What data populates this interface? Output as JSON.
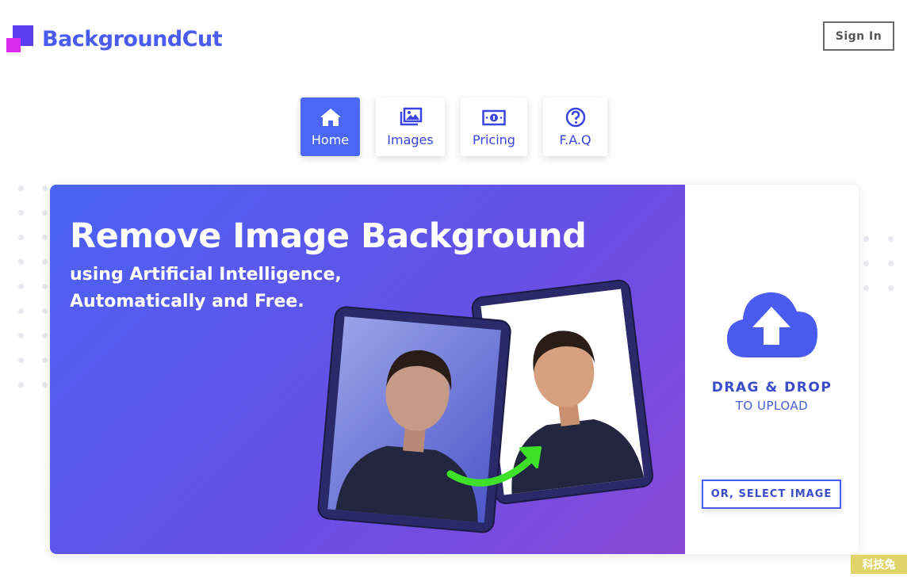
{
  "brand": {
    "name": "BackgroundCut"
  },
  "header": {
    "signin_label": "Sign In"
  },
  "nav": {
    "tabs": [
      {
        "label": "Home",
        "icon": "home-icon",
        "active": true
      },
      {
        "label": "Images",
        "icon": "images-icon",
        "active": false
      },
      {
        "label": "Pricing",
        "icon": "money-icon",
        "active": false
      },
      {
        "label": "F.A.Q",
        "icon": "question-icon",
        "active": false
      }
    ]
  },
  "hero": {
    "title": "Remove Image Background",
    "subtitle_line1": "using Artificial Intelligence,",
    "subtitle_line2": "Automatically and Free."
  },
  "upload": {
    "drag_title": "DRAG & DROP",
    "drag_subtitle": "TO UPLOAD",
    "select_label": "OR, SELECT IMAGE",
    "icon": "cloud-upload-icon"
  },
  "watermark": {
    "text": "科技兔"
  },
  "colors": {
    "brand": "#4a5cf0",
    "active_tab": "#4a68f5",
    "hero_gradient_start": "#4a63f3",
    "hero_gradient_end": "#8a48d6",
    "arrow_green": "#3ee02a"
  }
}
